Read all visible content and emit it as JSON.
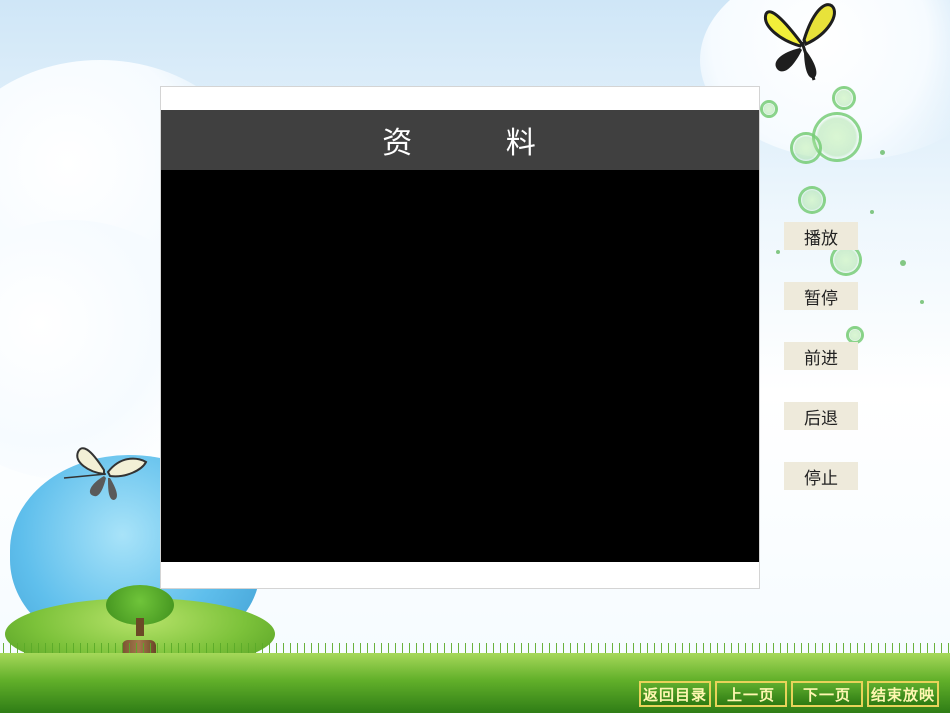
{
  "panel": {
    "title": "资  料"
  },
  "controls": {
    "play": "播放",
    "pause": "暂停",
    "forward": "前进",
    "back": "后退",
    "stop": "停止"
  },
  "nav": {
    "return_toc": "返回目录",
    "prev_page": "上一页",
    "next_page": "下一页",
    "end_show": "结束放映"
  },
  "colors": {
    "header_bg": "#404040",
    "video_bg": "#000000",
    "control_bg": "#eeeadb",
    "nav_bg": "#3a8a1a",
    "nav_border": "#e8d35a"
  }
}
